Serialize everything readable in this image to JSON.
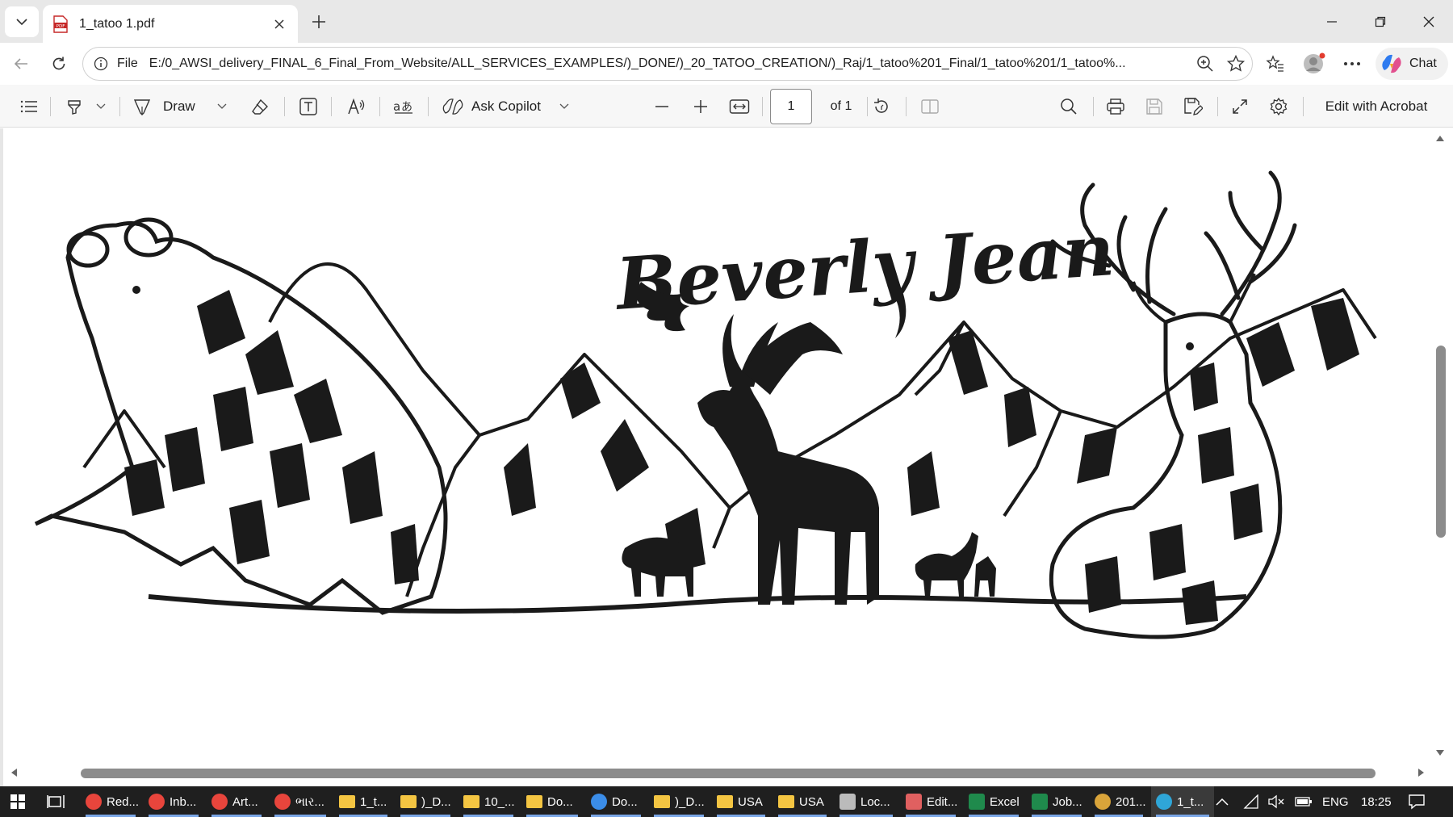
{
  "browser": {
    "tab_title": "1_tatoo 1.pdf",
    "url_scheme": "File",
    "url": "E:/0_AWSI_delivery_FINAL_6_Final_From_Website/ALL_SERVICES_EXAMPLES/)_DONE/)_20_TATOO_CREATION/)_Raj/1_tatoo%201_Final/1_tatoo%201/1_tatoo%...",
    "chat_label": "Chat"
  },
  "pdf_toolbar": {
    "draw_label": "Draw",
    "ask_copilot_label": "Ask Copilot",
    "page_number": "1",
    "page_total": "of 1",
    "edit_acrobat_label": "Edit with Acrobat"
  },
  "document": {
    "artwork_script_text": "Beverly Jean"
  },
  "taskbar": {
    "items": [
      {
        "label": "Red...",
        "icon": "chrome-icon",
        "color": "#e8453c"
      },
      {
        "label": "Inb...",
        "icon": "chrome-icon",
        "color": "#e8453c"
      },
      {
        "label": "Art...",
        "icon": "chrome-icon",
        "color": "#e8453c"
      },
      {
        "label": "ભાર...",
        "icon": "chrome-icon",
        "color": "#e8453c"
      },
      {
        "label": "1_t...",
        "icon": "folder-icon",
        "color": "#f4c542"
      },
      {
        "label": ")_D...",
        "icon": "folder-icon",
        "color": "#f4c542"
      },
      {
        "label": "10_...",
        "icon": "folder-icon",
        "color": "#f4c542"
      },
      {
        "label": "Do...",
        "icon": "folder-icon",
        "color": "#f4c542"
      },
      {
        "label": "Do...",
        "icon": "download-icon",
        "color": "#3b8de8"
      },
      {
        "label": ")_D...",
        "icon": "folder-icon",
        "color": "#f4c542"
      },
      {
        "label": "USA",
        "icon": "folder-icon",
        "color": "#f4c542"
      },
      {
        "label": "USA",
        "icon": "folder-icon",
        "color": "#f4c542"
      },
      {
        "label": "Loc...",
        "icon": "drive-icon",
        "color": "#bbbbbb"
      },
      {
        "label": "Edit...",
        "icon": "paint-icon",
        "color": "#e06060"
      },
      {
        "label": "Excel",
        "icon": "excel-icon",
        "color": "#1f8a4c"
      },
      {
        "label": "Job...",
        "icon": "excel-icon",
        "color": "#1f8a4c"
      },
      {
        "label": "201...",
        "icon": "app-icon",
        "color": "#d9a43a"
      },
      {
        "label": "1_t...",
        "icon": "edge-icon",
        "color": "#2fa6d8"
      }
    ],
    "language": "ENG",
    "time": "18:25"
  }
}
